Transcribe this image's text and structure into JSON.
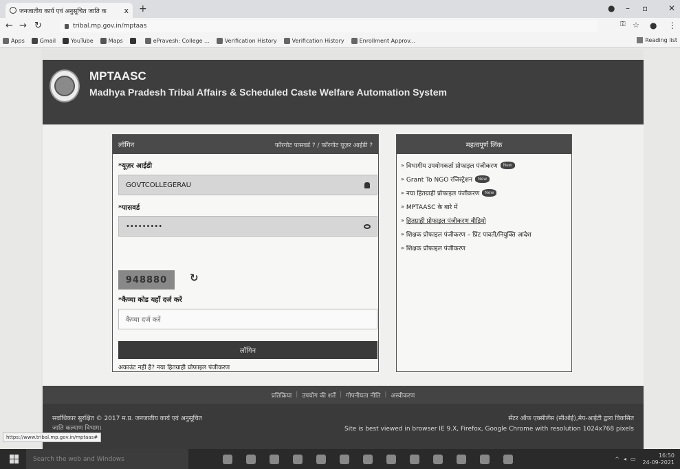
{
  "browser": {
    "tab_title": "जनजातीय कार्य एवं अनुसूचित जाति क",
    "tab_close": "x",
    "new_tab": "+",
    "url": "tribal.mp.gov.in/mptaas",
    "bookmarks": [
      {
        "label": "Apps",
        "color": "#6a6a6a"
      },
      {
        "label": "Gmail",
        "color": "#444"
      },
      {
        "label": "YouTube",
        "color": "#333"
      },
      {
        "label": "Maps",
        "color": "#555"
      },
      {
        "label": "",
        "color": "#333"
      },
      {
        "label": "ePravesh: College ...",
        "color": "#666"
      },
      {
        "label": "Verification History",
        "color": "#666"
      },
      {
        "label": "Verification History",
        "color": "#666"
      },
      {
        "label": "Enrollment Approv...",
        "color": "#666"
      }
    ],
    "reading_list": "Reading list"
  },
  "header": {
    "brand": "MPTAASC",
    "tagline": "Madhya Pradesh Tribal Affairs & Scheduled Caste Welfare Automation System"
  },
  "login": {
    "title": "लॉगिन",
    "forgot_links": "फॉरगोट पासवर्ड ? / फॉरगोट यूज़र आईडी ?",
    "user_id_label": "*यूज़र आईडी",
    "user_id_value": "GOVTCOLLEGERAU",
    "password_label": "*पासवर्ड",
    "password_value": "•••••••••",
    "captcha_value": "948880",
    "captcha_refresh": "↻",
    "captcha_label": "*कैप्चा कोड यहाँ दर्ज करें",
    "captcha_placeholder": "कैप्चा दर्ज करें",
    "submit": "लॉगिन",
    "register_text": "अकाउंट नहीं है? नया हितग्राही प्रोफाइल पंजीकरण"
  },
  "links": {
    "title": "महत्वपूर्ण लिंक",
    "new_badge": "New",
    "items": [
      {
        "text": "विभागीय उपयोगकर्ता प्रोफाइल पंजीकरण",
        "is_new": true
      },
      {
        "text": "Grant To NGO रजिस्ट्रेशन",
        "is_new": true
      },
      {
        "text": "नया हितग्राही प्रोफाइल पंजीकरण",
        "is_new": true
      },
      {
        "text": "MPTAASC के बारे में",
        "is_new": false
      },
      {
        "text": "हितग्राही प्रोफाइल पंजीकरण वीडियो",
        "is_new": false
      },
      {
        "text": "शिक्षक प्रोफाइल पंजीकरण – प्रिंट पावती/नियुक्ति आदेश",
        "is_new": false
      },
      {
        "text": "शिक्षक प्रोफाइल पंजीकरण",
        "is_new": false
      }
    ]
  },
  "footer": {
    "nav": [
      "प्रतिक्रिया",
      "उपयोग की शर्तें",
      "गोपनीयता नीति",
      "अस्वीकरण"
    ],
    "copyright": "सर्वाधिकार सुरक्षित © 2017 म.प्र. जनजातीय कार्य एवं अनुसूचित",
    "copyright2": "जाति कल्याण विभाग।",
    "credit": "सेंटर ऑफ एक्सीलेंस (सीओई),मेप-आईटी द्वारा विकसित",
    "best_view": "Site is best viewed in browser IE 9.X, Firefox, Google Chrome with resolution 1024x768 pixels"
  },
  "status_url": "https://www.tribal.mp.gov.in/mptaas#",
  "taskbar": {
    "search_placeholder": "Search the web and Windows",
    "time": "16:50",
    "date": "24-09-2021"
  }
}
